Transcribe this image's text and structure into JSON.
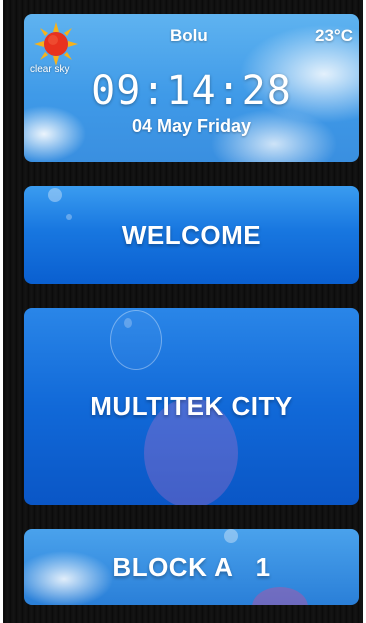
{
  "weather": {
    "icon": "sun-icon",
    "description": "clear sky",
    "city": "Bolu",
    "temperature": "23°C",
    "time": "09:14:28",
    "date": "04 May Friday"
  },
  "tiles": [
    {
      "label": "WELCOME"
    },
    {
      "label": "MULTITEK CITY"
    },
    {
      "label": "BLOCK A   1"
    }
  ],
  "colors": {
    "tile_blue": "#1877e0",
    "sky_blue": "#4fa6ee",
    "background": "#111111",
    "sun": "#e8321e"
  }
}
